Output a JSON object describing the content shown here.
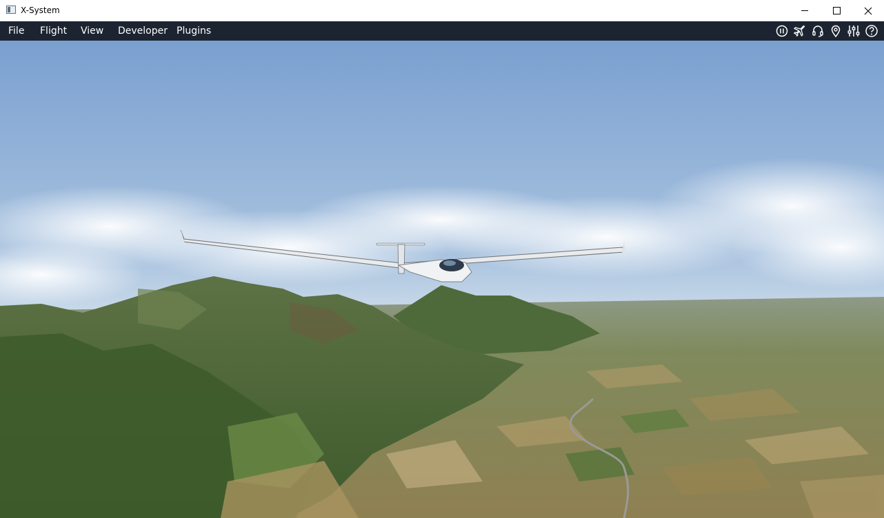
{
  "window": {
    "title": "X-System"
  },
  "menu": {
    "items": [
      {
        "label": "File"
      },
      {
        "label": "Flight"
      },
      {
        "label": "View"
      },
      {
        "label": "Developer"
      },
      {
        "label": "Plugins"
      }
    ]
  },
  "toolbar": {
    "icons": [
      "pause-icon",
      "airplane-icon",
      "headset-icon",
      "map-pin-icon",
      "sliders-icon",
      "help-icon"
    ]
  },
  "colors": {
    "menubar_bg": "#1d2431",
    "menu_text": "#ffffff",
    "sky_top": "#7ea3d4",
    "terrain_green": "#55733a"
  }
}
